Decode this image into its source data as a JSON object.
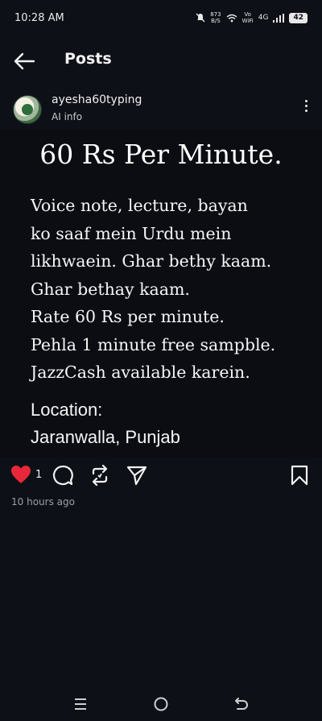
{
  "status_bar": {
    "time": "10:28 AM",
    "speed": "873",
    "speed_unit": "B/S",
    "volte": "Vo",
    "wifi_label": "WiFi",
    "network": "4G",
    "battery": "42"
  },
  "header": {
    "title": "Posts"
  },
  "author": {
    "name": "ayesha60typing",
    "sub": "AI info"
  },
  "post": {
    "title": "60 Rs Per Minute.",
    "lines": [
      "Voice note, lecture, bayan",
      "ko saaf mein Urdu mein",
      "likhwaein. Ghar bethy kaam.",
      "Ghar bethay kaam.",
      "Rate 60 Rs per minute.",
      "Pehla 1 minute free sampble.",
      "JazzCash available karein."
    ],
    "location_label": "Location:",
    "location_value": "Jaranwalla, Punjab"
  },
  "actions": {
    "like_count": "1",
    "like_color": "#e8283a"
  },
  "timestamp": "10 hours ago",
  "icons": {
    "back": "arrow-left-icon",
    "more": "more-vertical-icon",
    "like": "heart-icon",
    "comment": "comment-icon",
    "repost": "repost-icon",
    "share": "send-icon",
    "save": "bookmark-icon",
    "nav_menu": "menu-icon",
    "nav_home": "home-icon",
    "nav_back": "back-nav-icon"
  }
}
